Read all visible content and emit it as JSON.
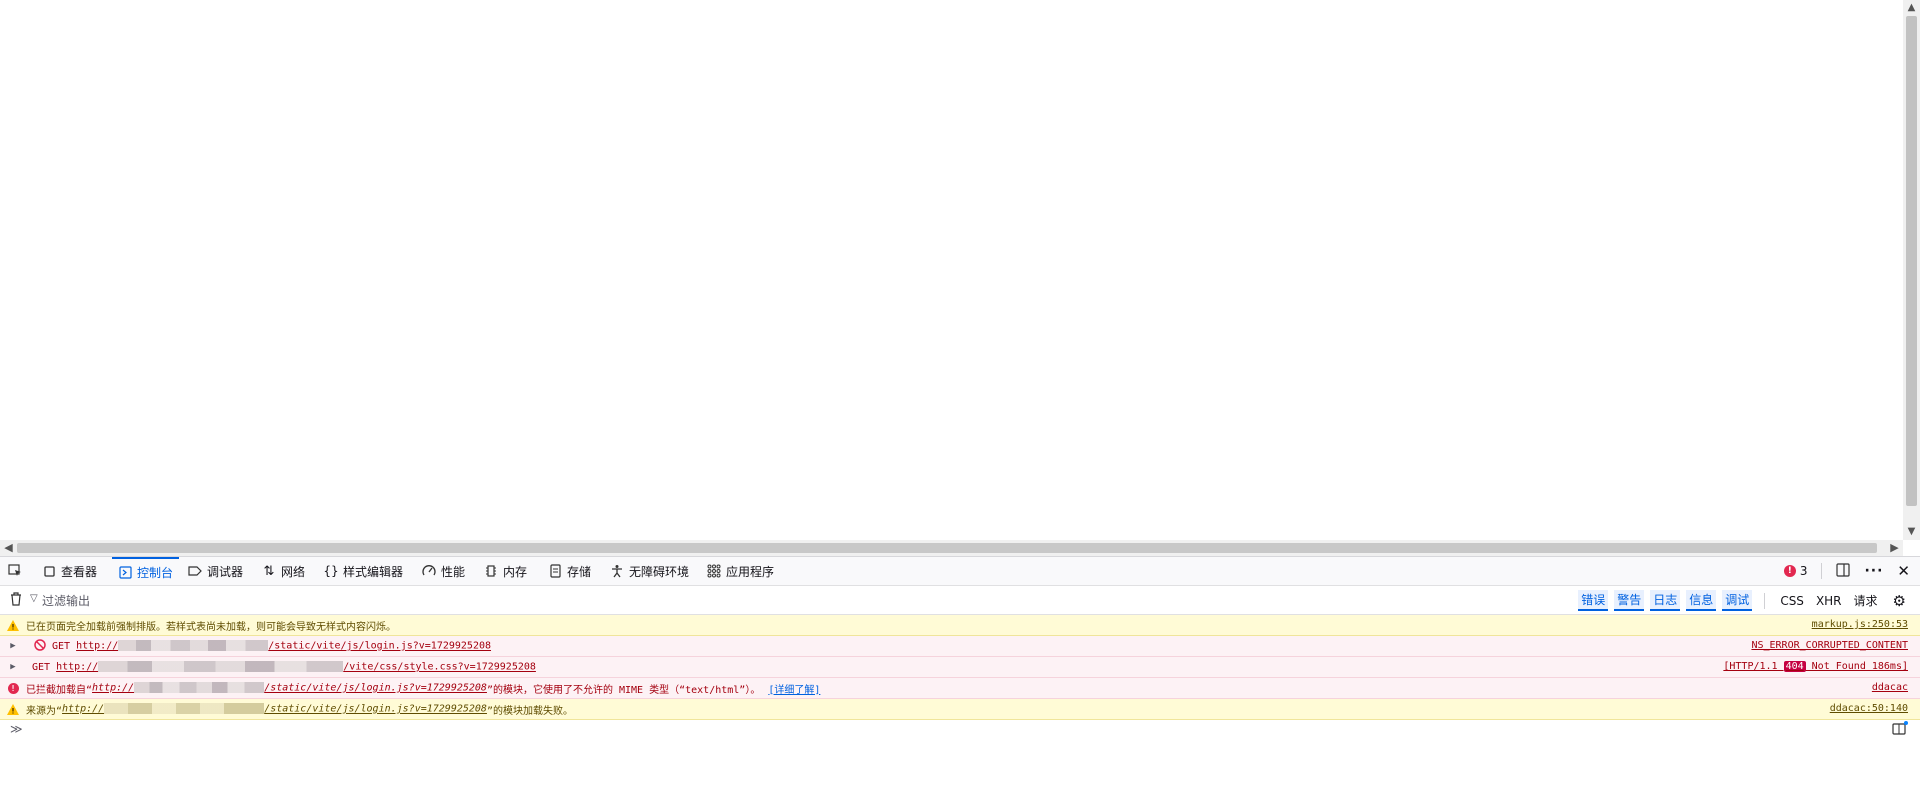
{
  "toolbar": {
    "tabs": [
      {
        "label": "查看器",
        "icon": "inspector-icon"
      },
      {
        "label": "控制台",
        "icon": "console-icon",
        "active": true
      },
      {
        "label": "调试器",
        "icon": "debugger-icon"
      },
      {
        "label": "网络",
        "icon": "network-icon"
      },
      {
        "label": "样式编辑器",
        "icon": "style-editor-icon"
      },
      {
        "label": "性能",
        "icon": "performance-icon"
      },
      {
        "label": "内存",
        "icon": "memory-icon"
      },
      {
        "label": "存储",
        "icon": "storage-icon"
      },
      {
        "label": "无障碍环境",
        "icon": "accessibility-icon"
      },
      {
        "label": "应用程序",
        "icon": "application-icon"
      }
    ],
    "error_count": "3"
  },
  "filter": {
    "placeholder": "过滤输出",
    "levels": [
      "错误",
      "警告",
      "日志",
      "信息",
      "调试"
    ],
    "types": [
      "CSS",
      "XHR",
      "请求"
    ]
  },
  "messages": [
    {
      "level": "warn",
      "text": "已在页面完全加载前强制排版。若样式表尚未加载，则可能会导致无样式内容闪烁。",
      "source": "markup.js:250:53"
    },
    {
      "level": "err",
      "method": "GET",
      "url_prefix": "http://",
      "url_path": "/static/vite/js/login.js?v=1729925208",
      "source": "NS_ERROR_CORRUPTED_CONTENT"
    },
    {
      "level": "err",
      "method": "GET",
      "url_prefix": "http://",
      "url_path": "/vite/css/style.css?v=1729925208",
      "status_prefix": "[HTTP/1.1 ",
      "status_code": "404",
      "status_suffix": " Not Found 186ms]"
    },
    {
      "level": "err",
      "text_prefix": "已拦截加载自“",
      "url_prefix": "http://",
      "url_path": "/static/vite/js/login.js?v=1729925208",
      "text_suffix": "”的模块，它使用了不允许的 MIME 类型（“text/html”）。",
      "learn_more": "[详细了解]",
      "source": "ddacac"
    },
    {
      "level": "warn",
      "text_prefix": "来源为“",
      "url_prefix": "http://",
      "url_path": "/static/vite/js/login.js?v=1729925208",
      "text_suffix": "”的模块加载失败。",
      "source": "ddacac:50:140"
    }
  ],
  "colors": {
    "accent": "#0061e0",
    "error": "#a4000f",
    "warning": "#5f4c00"
  }
}
